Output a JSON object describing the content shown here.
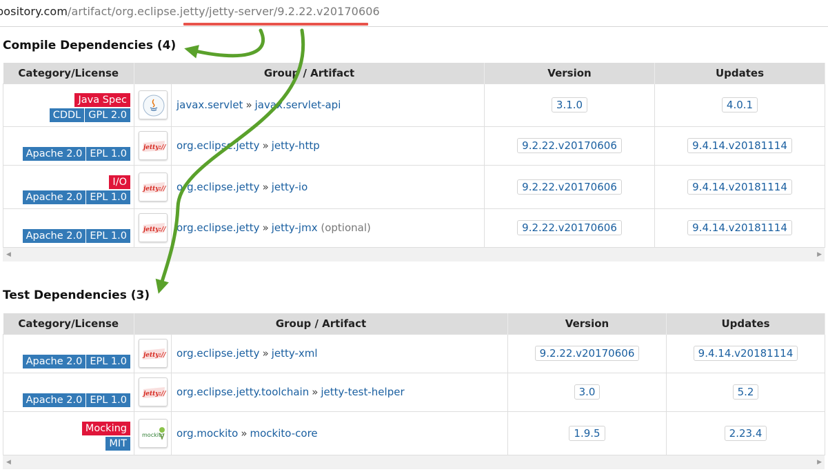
{
  "url": {
    "host": "pository.com",
    "path": "/artifact/org.eclipse.jetty/jetty-server/9.2.22.v20170606"
  },
  "colors": {
    "license_badge": "#337ab7",
    "category_badge": "#e0153a",
    "link": "#1a5fa0",
    "annotation_arrow": "#5aa12b",
    "url_underline": "#e8544c"
  },
  "compile": {
    "title": "Compile Dependencies (4)",
    "headers": {
      "category": "Category/License",
      "artifact": "Group / Artifact",
      "version": "Version",
      "updates": "Updates"
    },
    "rows": [
      {
        "categories": [
          "Java Spec"
        ],
        "licenses": [
          "CDDL",
          "GPL 2.0"
        ],
        "logo": "java-logo",
        "group": "javax.servlet",
        "artifact": "javax.servlet-api",
        "note": "",
        "version": "3.1.0",
        "update": "4.0.1"
      },
      {
        "categories": [],
        "licenses": [
          "Apache 2.0",
          "EPL 1.0"
        ],
        "logo": "jetty-logo",
        "group": "org.eclipse.jetty",
        "artifact": "jetty-http",
        "note": "",
        "version": "9.2.22.v20170606",
        "update": "9.4.14.v20181114"
      },
      {
        "categories": [
          "I/O"
        ],
        "licenses": [
          "Apache 2.0",
          "EPL 1.0"
        ],
        "logo": "jetty-logo",
        "group": "org.eclipse.jetty",
        "artifact": "jetty-io",
        "note": "",
        "version": "9.2.22.v20170606",
        "update": "9.4.14.v20181114"
      },
      {
        "categories": [],
        "licenses": [
          "Apache 2.0",
          "EPL 1.0"
        ],
        "logo": "jetty-logo",
        "group": "org.eclipse.jetty",
        "artifact": "jetty-jmx",
        "note": "(optional)",
        "version": "9.2.22.v20170606",
        "update": "9.4.14.v20181114"
      }
    ]
  },
  "test": {
    "title": "Test Dependencies (3)",
    "headers": {
      "category": "Category/License",
      "artifact": "Group / Artifact",
      "version": "Version",
      "updates": "Updates"
    },
    "rows": [
      {
        "categories": [],
        "licenses": [
          "Apache 2.0",
          "EPL 1.0"
        ],
        "logo": "jetty-logo",
        "group": "org.eclipse.jetty",
        "artifact": "jetty-xml",
        "note": "",
        "version": "9.2.22.v20170606",
        "update": "9.4.14.v20181114"
      },
      {
        "categories": [],
        "licenses": [
          "Apache 2.0",
          "EPL 1.0"
        ],
        "logo": "jetty-logo",
        "group": "org.eclipse.jetty.toolchain",
        "artifact": "jetty-test-helper",
        "note": "",
        "version": "3.0",
        "update": "5.2"
      },
      {
        "categories": [
          "Mocking"
        ],
        "licenses": [
          "MIT"
        ],
        "logo": "mockito-logo",
        "group": "org.mockito",
        "artifact": "mockito-core",
        "note": "",
        "version": "1.9.5",
        "update": "2.23.4"
      }
    ]
  },
  "logo_text": {
    "jetty": "jetty://",
    "mockito": "mockito"
  },
  "separator": "»"
}
